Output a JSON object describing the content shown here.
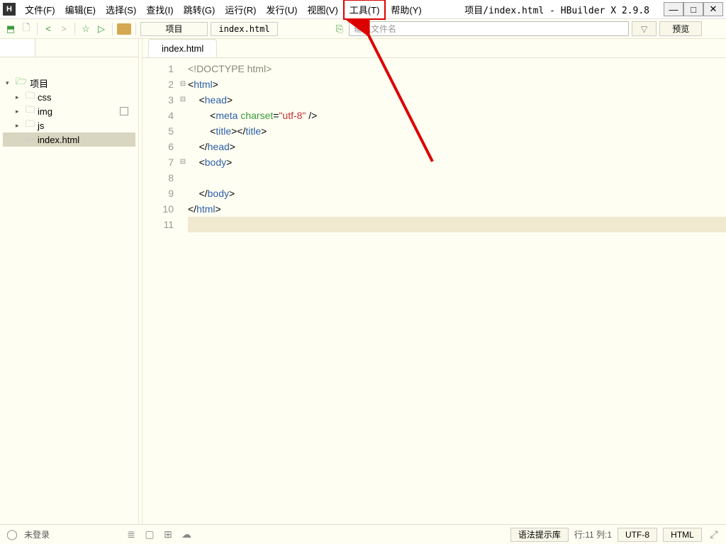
{
  "app_icon": "H",
  "window_title": "项目/index.html - HBuilder X 2.9.8",
  "menu": {
    "file": "文件(F)",
    "edit": "编辑(E)",
    "select": "选择(S)",
    "find": "查找(I)",
    "goto": "跳转(G)",
    "run": "运行(R)",
    "release": "发行(U)",
    "view": "视图(V)",
    "tools": "工具(T)",
    "help": "帮助(Y)"
  },
  "toolbar": {
    "project_btn": "项目",
    "file_btn": "index.html",
    "search_placeholder": "输入文件名",
    "preview_btn": "预览"
  },
  "tree": {
    "root": "项目",
    "folders": [
      "css",
      "img",
      "js"
    ],
    "file": "index.html"
  },
  "editor": {
    "tab": "index.html",
    "lines": [
      {
        "n": "1",
        "fold": "",
        "ind": 0,
        "seg": [
          {
            "c": "t-gray",
            "t": "<!DOCTYPE html>"
          }
        ]
      },
      {
        "n": "2",
        "fold": "⊟",
        "ind": 0,
        "seg": [
          {
            "c": "",
            "t": "<"
          },
          {
            "c": "t-blue",
            "t": "html"
          },
          {
            "c": "",
            "t": ">"
          }
        ]
      },
      {
        "n": "3",
        "fold": "⊟",
        "ind": 1,
        "seg": [
          {
            "c": "",
            "t": "<"
          },
          {
            "c": "t-blue",
            "t": "head"
          },
          {
            "c": "",
            "t": ">"
          }
        ]
      },
      {
        "n": "4",
        "fold": "",
        "ind": 2,
        "seg": [
          {
            "c": "",
            "t": "<"
          },
          {
            "c": "t-blue",
            "t": "meta"
          },
          {
            "c": "",
            "t": " "
          },
          {
            "c": "t-green",
            "t": "charset"
          },
          {
            "c": "",
            "t": "="
          },
          {
            "c": "t-red",
            "t": "\"utf-8\""
          },
          {
            "c": "",
            "t": " />"
          }
        ]
      },
      {
        "n": "5",
        "fold": "",
        "ind": 2,
        "seg": [
          {
            "c": "",
            "t": "<"
          },
          {
            "c": "t-blue",
            "t": "title"
          },
          {
            "c": "",
            "t": "></"
          },
          {
            "c": "t-blue",
            "t": "title"
          },
          {
            "c": "",
            "t": ">"
          }
        ]
      },
      {
        "n": "6",
        "fold": "",
        "ind": 1,
        "seg": [
          {
            "c": "",
            "t": "</"
          },
          {
            "c": "t-blue",
            "t": "head"
          },
          {
            "c": "",
            "t": ">"
          }
        ]
      },
      {
        "n": "7",
        "fold": "⊟",
        "ind": 1,
        "seg": [
          {
            "c": "",
            "t": "<"
          },
          {
            "c": "t-blue",
            "t": "body"
          },
          {
            "c": "",
            "t": ">"
          }
        ]
      },
      {
        "n": "8",
        "fold": "",
        "ind": 2,
        "seg": []
      },
      {
        "n": "9",
        "fold": "",
        "ind": 1,
        "seg": [
          {
            "c": "",
            "t": "</"
          },
          {
            "c": "t-blue",
            "t": "body"
          },
          {
            "c": "",
            "t": ">"
          }
        ]
      },
      {
        "n": "10",
        "fold": "",
        "ind": 0,
        "seg": [
          {
            "c": "",
            "t": "</"
          },
          {
            "c": "t-blue",
            "t": "html"
          },
          {
            "c": "",
            "t": ">"
          }
        ]
      },
      {
        "n": "11",
        "fold": "",
        "ind": 0,
        "seg": [],
        "hl": true
      }
    ]
  },
  "statusbar": {
    "login": "未登录",
    "syntax": "语法提示库",
    "cursor": "行:11 列:1",
    "encoding": "UTF-8",
    "lang": "HTML"
  }
}
